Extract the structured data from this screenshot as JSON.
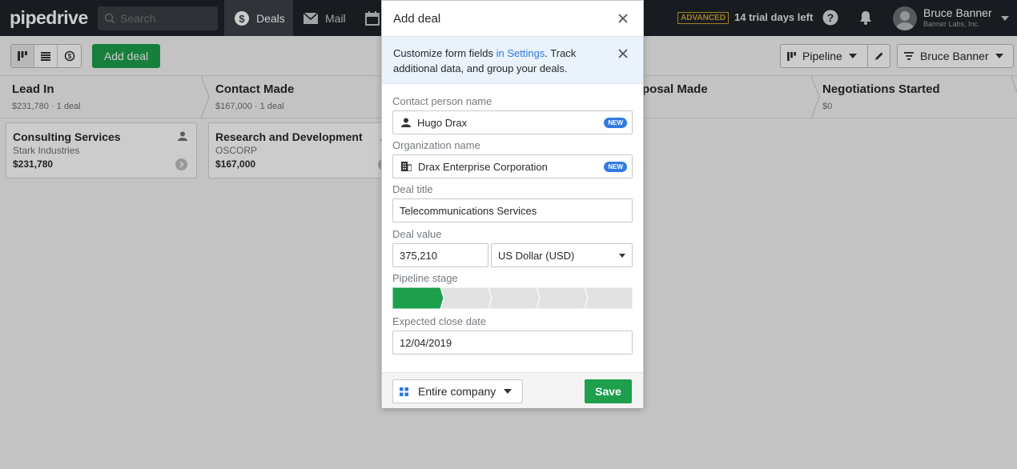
{
  "app": {
    "logo": "pipedrive"
  },
  "topbar": {
    "search_placeholder": "Search",
    "nav": {
      "deals": "Deals",
      "mail": "Mail"
    },
    "advanced_badge": "ADVANCED",
    "trial_text": "14 trial days left",
    "user_name": "Bruce Banner",
    "user_company": "Banner Labs, Inc."
  },
  "toolbar": {
    "add_deal": "Add deal",
    "pipeline": "Pipeline",
    "filter_user": "Bruce Banner"
  },
  "stages": [
    {
      "name": "Lead In",
      "meta": "$231,780 · 1 deal"
    },
    {
      "name": "Contact Made",
      "meta": "$167,000 · 1 deal"
    },
    {
      "name": "Proposal Made",
      "meta": ""
    },
    {
      "name": "Negotiations Started",
      "meta": "$0"
    }
  ],
  "cards": [
    {
      "title": "Consulting Services",
      "org": "Stark Industries",
      "value": "$231,780"
    },
    {
      "title": "Research and Development",
      "org": "OSCORP",
      "value": "$167,000"
    }
  ],
  "modal": {
    "title": "Add deal",
    "notice_pre": "Customize form fields ",
    "notice_link": "in Settings",
    "notice_post": ". Track additional data, and group your deals.",
    "contact_label": "Contact person name",
    "contact_value": "Hugo Drax",
    "org_label": "Organization name",
    "org_value": "Drax Enterprise Corporation",
    "new_badge": "NEW",
    "deal_title_label": "Deal title",
    "deal_title_value": "Telecommunications Services",
    "deal_value_label": "Deal value",
    "deal_value": "375,210",
    "currency": "US Dollar (USD)",
    "pipeline_stage_label": "Pipeline stage",
    "pipeline_stage_selected": 1,
    "pipeline_stage_count": 5,
    "close_date_label": "Expected close date",
    "close_date_value": "12/04/2019",
    "visibility": "Entire company",
    "save": "Save"
  },
  "colors": {
    "brand_green": "#1d9f4c",
    "link_blue": "#317ae2",
    "topbar": "#1f2328"
  }
}
